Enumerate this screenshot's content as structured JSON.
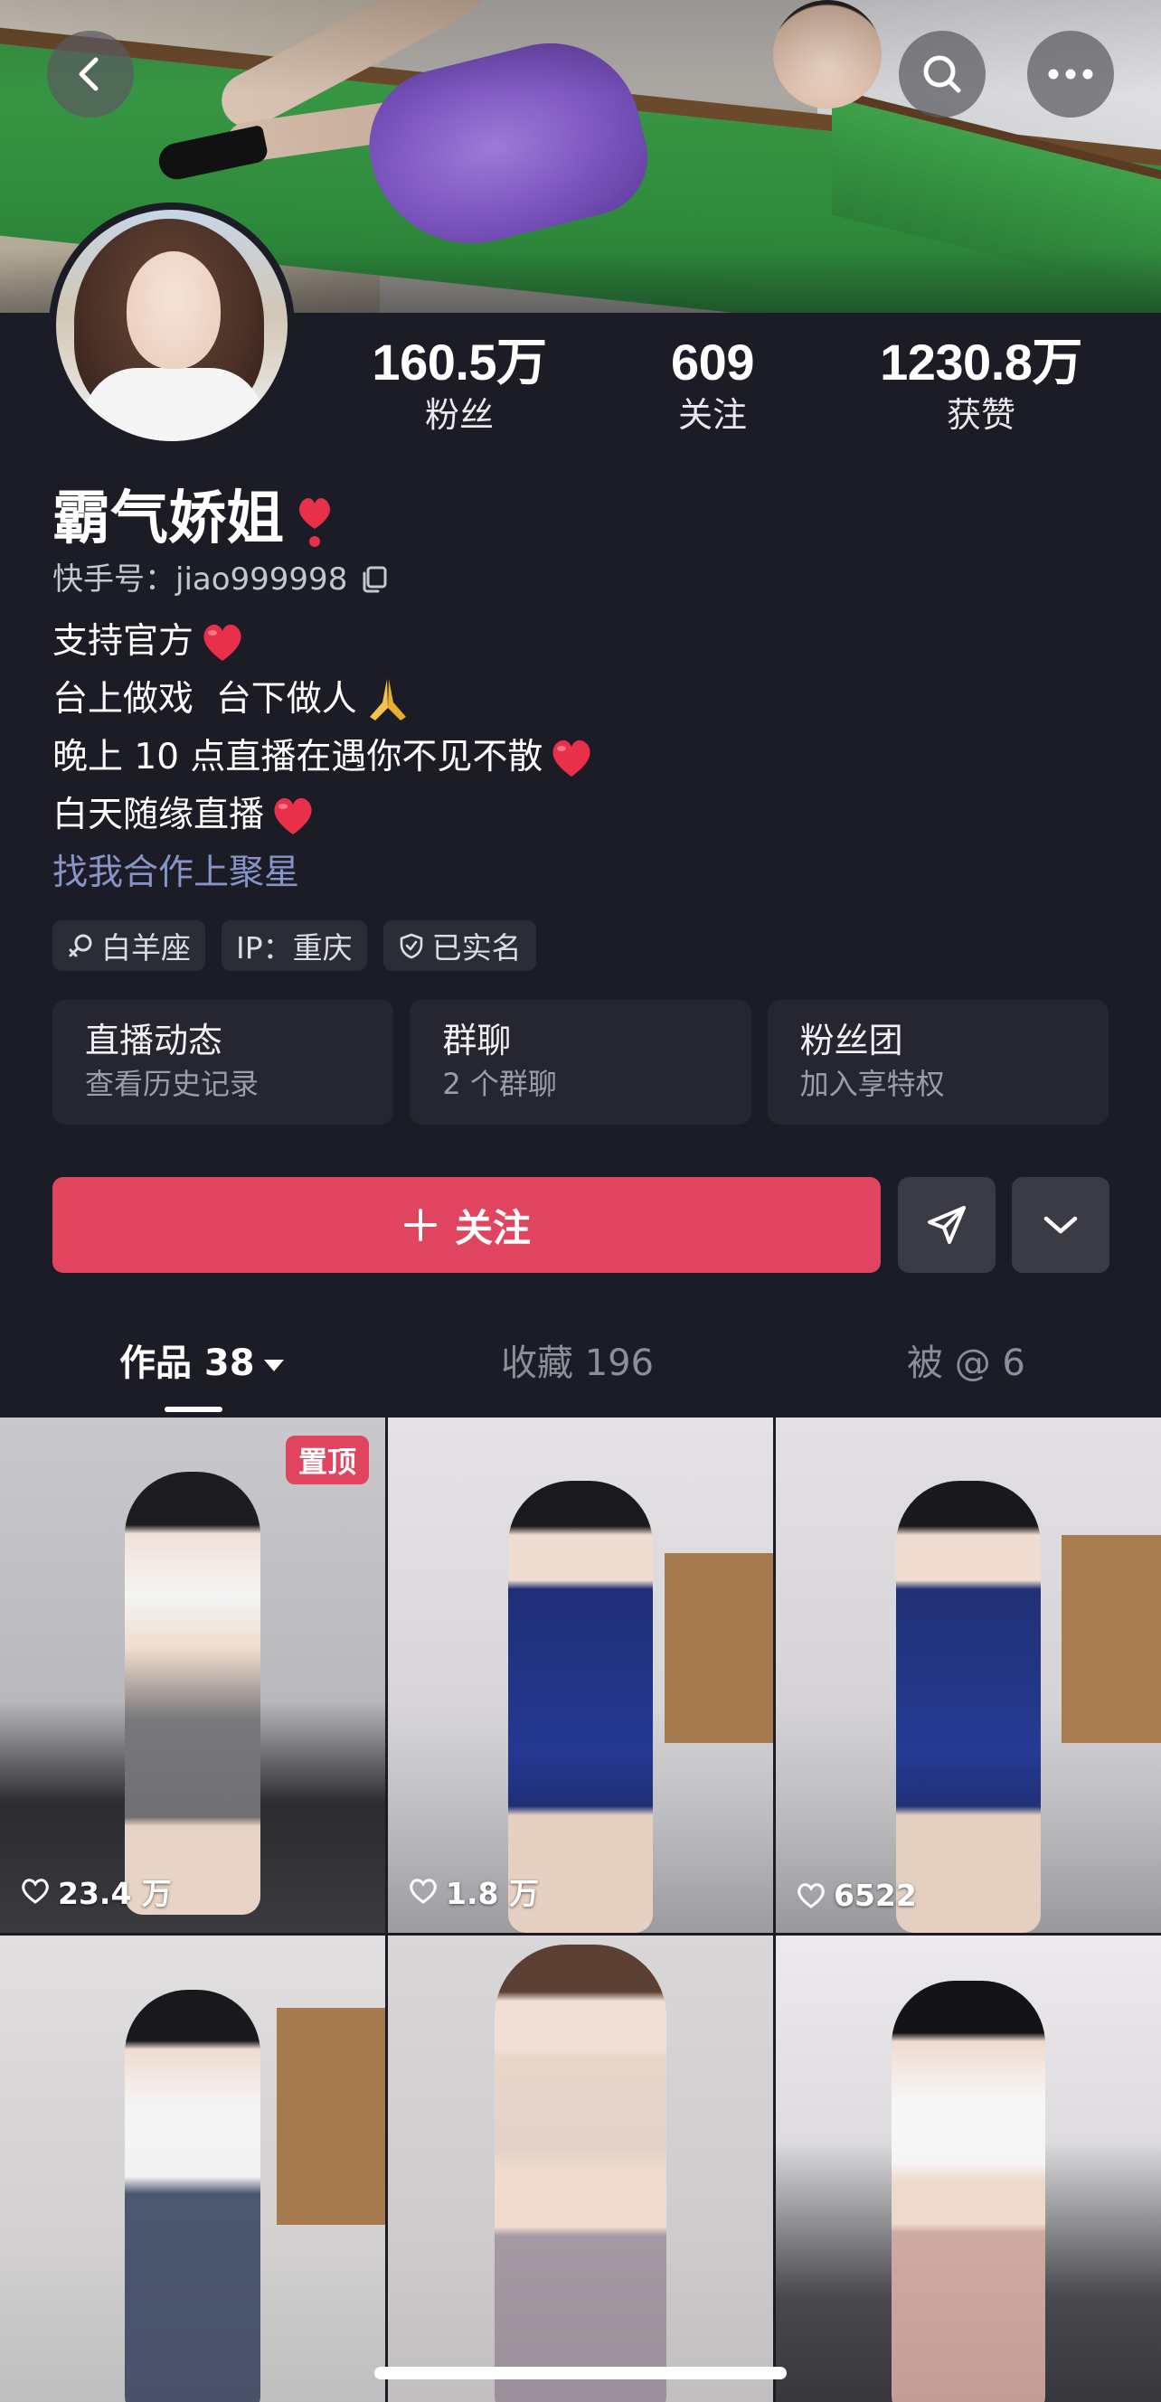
{
  "profile": {
    "display_name": "霸气娇姐",
    "kuaishou_id": "快手号：jiao999998",
    "stats": [
      {
        "value": "160.5万",
        "label": "粉丝"
      },
      {
        "value": "609",
        "label": "关注"
      },
      {
        "value": "1230.8万",
        "label": "获赞"
      }
    ],
    "bio_lines": [
      "支持官方",
      "台上做戏  台下做人",
      "晚上 10 点直播在遇你不见不散",
      "白天随缘直播"
    ],
    "cooperation_link": "找我合作上聚星",
    "tags": [
      "白羊座",
      "IP：重庆",
      "已实名"
    ]
  },
  "cards": [
    {
      "title": "直播动态",
      "subtitle": "查看历史记录"
    },
    {
      "title": "群聊",
      "subtitle": "2 个群聊"
    },
    {
      "title": "粉丝团",
      "subtitle": "加入享特权"
    }
  ],
  "actions": {
    "follow_label": "关注"
  },
  "tabs": [
    {
      "label": "作品 38"
    },
    {
      "label": "收藏 196"
    },
    {
      "label": "被 @ 6"
    }
  ],
  "pinned_badge": "置顶",
  "videos": [
    {
      "likes": "23.4 万"
    },
    {
      "likes": "1.8 万"
    },
    {
      "likes": "6522"
    }
  ],
  "colors": {
    "background": "#1b1c25",
    "accent": "#e1445f",
    "link": "#8894c8"
  },
  "icons": [
    "back-arrow-icon",
    "search-icon",
    "more-icon",
    "heart-icon",
    "copy-icon",
    "prayer-hands-icon",
    "gender-female-icon",
    "verified-shield-icon",
    "plus-icon",
    "share-icon",
    "chevron-down-icon"
  ]
}
